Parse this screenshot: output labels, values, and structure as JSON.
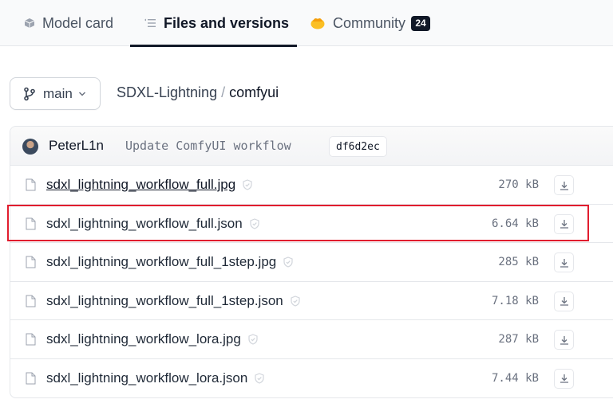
{
  "tabs": [
    {
      "label": "Model card",
      "icon": "cube-icon",
      "active": false
    },
    {
      "label": "Files and versions",
      "icon": "files-list-icon",
      "active": true
    },
    {
      "label": "Community",
      "icon": "community-icon",
      "active": false,
      "badge": "24"
    }
  ],
  "branch": {
    "label": "main",
    "icon": "branch-icon"
  },
  "breadcrumb": {
    "repo": "SDXL-Lightning",
    "separator": "/",
    "folder": "comfyui"
  },
  "commit": {
    "author": "PeterL1n",
    "message": "Update ComfyUI workflow",
    "hash": "df6d2ec"
  },
  "files": [
    {
      "name": "sdxl_lightning_workflow_full.jpg",
      "size": "270 kB",
      "underlined": true
    },
    {
      "name": "sdxl_lightning_workflow_full.json",
      "size": "6.64 kB",
      "highlighted": true
    },
    {
      "name": "sdxl_lightning_workflow_full_1step.jpg",
      "size": "285 kB"
    },
    {
      "name": "sdxl_lightning_workflow_full_1step.json",
      "size": "7.18 kB"
    },
    {
      "name": "sdxl_lightning_workflow_lora.jpg",
      "size": "287 kB"
    },
    {
      "name": "sdxl_lightning_workflow_lora.json",
      "size": "7.44 kB"
    }
  ],
  "colors": {
    "highlight": "#e11d2e",
    "community_icon": "#f59e0b",
    "active_tab": "#111827"
  }
}
